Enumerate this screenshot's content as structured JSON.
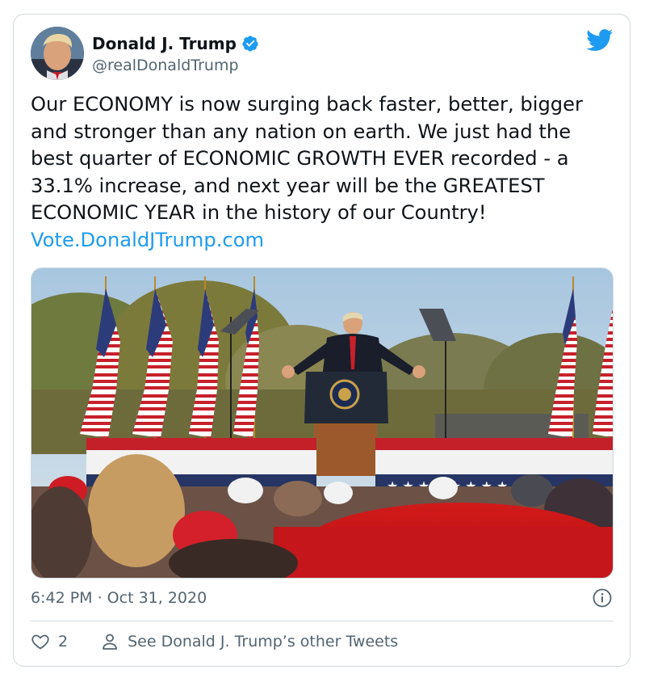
{
  "author": {
    "name": "Donald J. Trump",
    "handle": "@realDonaldTrump"
  },
  "tweet": {
    "text": "Our ECONOMY is now surging back faster, better, bigger and stronger than any nation on earth. We just had the best quarter of ECONOMIC GROWTH EVER recorded - a 33.1% increase, and next year will be the GREATEST ECONOMIC YEAR in the history of our Country! ",
    "link": "Vote.DonaldJTrump.com",
    "timestamp": "6:42 PM · Oct 31, 2020"
  },
  "actions": {
    "like_count": "2",
    "other_tweets_label": "See Donald J. Trump’s other Tweets"
  },
  "colors": {
    "accent": "#1d9bf0",
    "text": "#0f1419",
    "muted": "#536471",
    "border": "#cfd9de"
  },
  "icons": [
    "verified-badge-icon",
    "twitter-bird-icon",
    "info-icon",
    "heart-icon",
    "person-icon"
  ]
}
